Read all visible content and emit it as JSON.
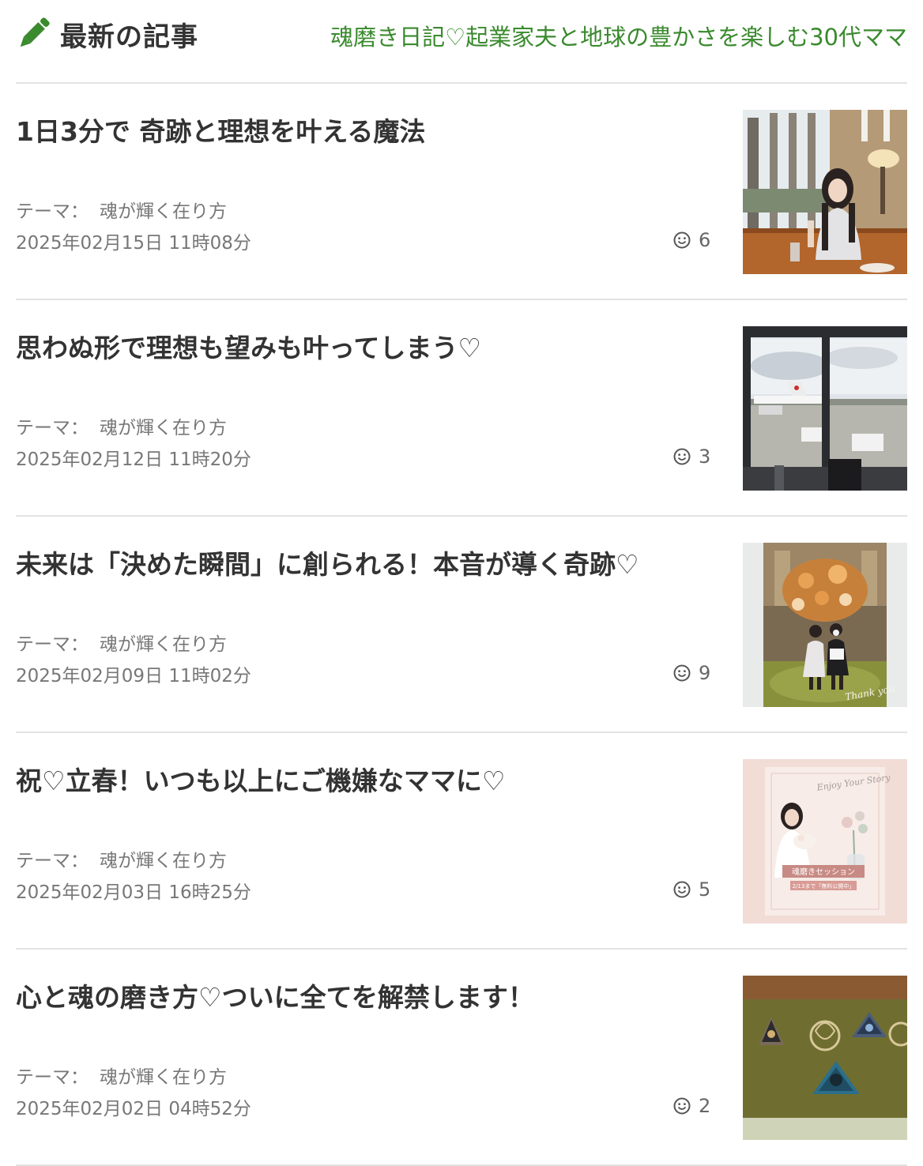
{
  "header": {
    "title": "最新の記事",
    "blog_title": "魂磨き日記♡起業家夫と地球の豊かさを楽しむ30代ママ",
    "accent_color": "#3a8a2e"
  },
  "articles": [
    {
      "title": "1日3分で 奇跡と理想を叶える魔法",
      "theme_label": "テーマ：",
      "theme": "魂が輝く在り方",
      "date": "2025年02月15日 11時08分",
      "likes": "6",
      "thumbnail": "woman-at-hotel-lounge-photo"
    },
    {
      "title": "思わぬ形で理想も望みも叶ってしまう♡",
      "theme_label": "テーマ：",
      "theme": "魂が輝く在り方",
      "date": "2025年02月12日 11時20分",
      "likes": "3",
      "thumbnail": "airport-window-airplane-photo"
    },
    {
      "title": "未来は「決めた瞬間」に創られる！本音が導く奇跡♡",
      "theme_label": "テーマ：",
      "theme": "魂が輝く在り方",
      "date": "2025年02月09日 11時02分",
      "likes": "9",
      "thumbnail": "two-women-flower-display-photo"
    },
    {
      "title": "祝♡立春！いつも以上にご機嫌なママに♡",
      "theme_label": "テーマ：",
      "theme": "魂が輝く在り方",
      "date": "2025年02月03日 16時25分",
      "likes": "5",
      "thumbnail": "soul-polishing-session-flyer"
    },
    {
      "title": "心と魂の磨き方♡ついに全てを解禁します！",
      "theme_label": "テーマ：",
      "theme": "魂が輝く在り方",
      "date": "2025年02月02日 04時52分",
      "likes": "2",
      "thumbnail": "orgonite-crystals-on-cloth-photo"
    }
  ],
  "thumb_texts": {
    "flyer_script": "Enjoy Your Story",
    "flyer_banner": "魂磨きセッション",
    "flyer_note": "2/13まで「無料公開中」",
    "flower_script": "Thank you"
  }
}
